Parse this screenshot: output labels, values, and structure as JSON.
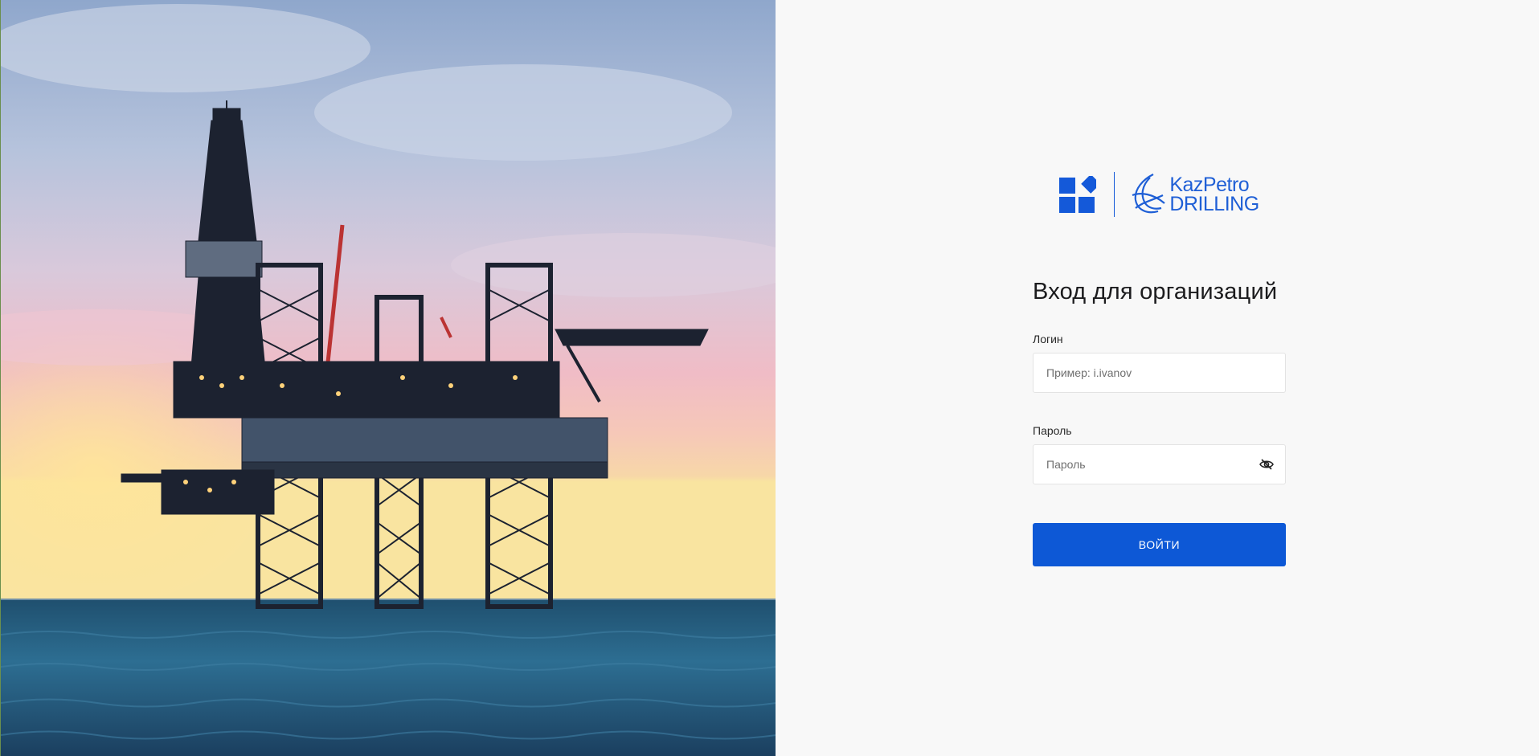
{
  "hero": {
    "image_description_icon": "offshore-oil-rig-image"
  },
  "brand": {
    "org_logo_icon": "squares-diamond-logo-icon",
    "partner_logo_icon": "kazpetro-swirl-logo-icon",
    "partner_name_line1": "KazPetro",
    "partner_name_line2": "DRILLING",
    "brand_color": "#1f5fd6"
  },
  "login": {
    "title": "Вход для организаций",
    "login_label": "Логин",
    "login_placeholder": "Пример: i.ivanov",
    "login_value": "",
    "password_label": "Пароль",
    "password_placeholder": "Пароль",
    "password_value": "",
    "password_toggle_icon": "eye-off-icon",
    "submit_label": "ВОЙТИ",
    "button_color": "#0d58d6"
  }
}
